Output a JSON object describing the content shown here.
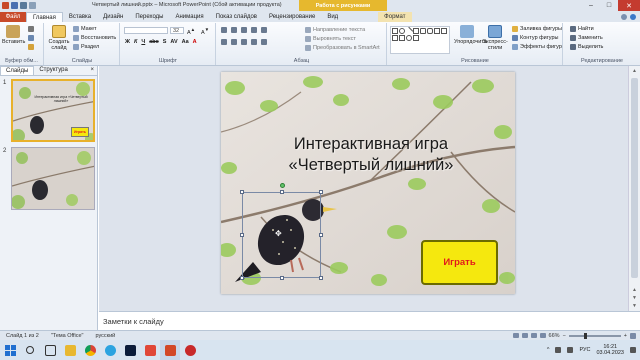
{
  "titlebar": {
    "title": "Четвертый лишний.pptx – Microsoft PowerPoint (Сбой активации продукта)",
    "context_header": "Работа с рисунками",
    "window_controls": [
      "–",
      "□",
      "✕"
    ]
  },
  "tabs": [
    {
      "label": "Файл",
      "kind": "file"
    },
    {
      "label": "Главная",
      "kind": "active"
    },
    {
      "label": "Вставка",
      "kind": "normal"
    },
    {
      "label": "Дизайн",
      "kind": "normal"
    },
    {
      "label": "Переходы",
      "kind": "normal"
    },
    {
      "label": "Анимация",
      "kind": "normal"
    },
    {
      "label": "Показ слайдов",
      "kind": "normal"
    },
    {
      "label": "Рецензирование",
      "kind": "normal"
    },
    {
      "label": "Вид",
      "kind": "normal"
    },
    {
      "label": "Формат",
      "kind": "context"
    }
  ],
  "ribbon": {
    "clipboard": {
      "paste": "Вставить",
      "label": "Буфер обм..."
    },
    "slides": {
      "new_slide": "Создать слайд",
      "layout": "Макет",
      "reset": "Восстановить",
      "section": "Раздел",
      "label": "Слайды"
    },
    "font": {
      "size": "32",
      "label": "Шрифт"
    },
    "paragraph": {
      "text_direction": "Направление текста",
      "align_text": "Выровнять текст",
      "smartart": "Преобразовать в SmartArt",
      "label": "Абзац"
    },
    "drawing": {
      "arrange": "Упорядочить",
      "quick_styles": "Экспресс-стили",
      "fill": "Заливка фигуры",
      "outline": "Контур фигуры",
      "effects": "Эффекты фигур",
      "label": "Рисование"
    },
    "editing": {
      "find": "Найти",
      "replace": "Заменить",
      "select": "Выделить",
      "label": "Редактирование"
    }
  },
  "left_pane": {
    "tabs": [
      "Слайды",
      "Структура"
    ],
    "close": "×",
    "thumbnails": [
      {
        "number": "1",
        "title": "Интерактивная игра «Четвертый лишний»",
        "button": "Играть",
        "selected": true
      },
      {
        "number": "2",
        "selected": false
      }
    ]
  },
  "slide": {
    "title_line1": "Интерактивная игра",
    "title_line2": "«Четвертый лишний»",
    "play_button": "Играть",
    "colors": {
      "button_fill": "#f5e80e",
      "button_text": "#e21b1b"
    }
  },
  "notes": {
    "placeholder": "Заметки к слайду"
  },
  "status": {
    "slide_counter": "Слайд 1 из 2",
    "theme": "\"Тема Office\"",
    "language": "русский",
    "zoom": "66%",
    "zoom_level_pct": 66
  },
  "taskbar": {
    "language": "РУС",
    "time": "16:21",
    "date": "03.04.2023",
    "apps": [
      "explorer",
      "chrome",
      "telegram",
      "photoshop",
      "ppt-color",
      "powerpoint",
      "recorder"
    ]
  }
}
